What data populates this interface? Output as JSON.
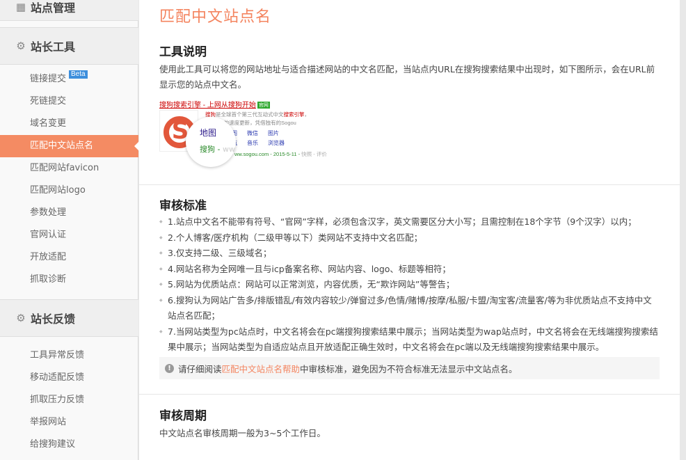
{
  "sidebar": {
    "top_section": {
      "label": "站点管理",
      "icon": "grid-icon"
    },
    "tools_section": {
      "label": "站长工具",
      "icon": "gear-icon"
    },
    "tools_items": [
      {
        "label": "链接提交",
        "badge": "Beta"
      },
      {
        "label": "死链提交"
      },
      {
        "label": "域名变更"
      },
      {
        "label": "匹配中文站点名",
        "active": true
      },
      {
        "label": "匹配网站favicon"
      },
      {
        "label": "匹配网站logo"
      },
      {
        "label": "参数处理"
      },
      {
        "label": "官网认证"
      },
      {
        "label": "开放适配"
      },
      {
        "label": "抓取诊断"
      }
    ],
    "feedback_section": {
      "label": "站长反馈",
      "icon": "gear-icon"
    },
    "feedback_items": [
      {
        "label": "工具异常反馈"
      },
      {
        "label": "移动适配反馈"
      },
      {
        "label": "抓取压力反馈"
      },
      {
        "label": "举报网站"
      },
      {
        "label": "给搜狗建议"
      }
    ]
  },
  "main": {
    "title": "匹配中文站点名",
    "intro_heading": "工具说明",
    "intro_text": "使用此工具可以将您的网站地址与适合描述网站的中文名匹配，当站点内URL在搜狗搜索结果中出现时，如下图所示，会在URL前显示您的站点中文名。",
    "example": {
      "title": "搜狗搜索引擎 - 上网从搜狗开始",
      "official": "官网",
      "line1_prefix": "搜狗",
      "line1_mid": "是全球首个第三代互动式中文",
      "line1_hl": "搜索引擎",
      "line1_suffix": "，",
      "line2": "天以5亿的速度更新，凭借独有的Sogou",
      "links_row1": [
        "地图",
        "微信",
        "图片"
      ],
      "links_row2": [
        "导航",
        "音乐",
        "浏览器"
      ],
      "url": "ww.sogou.com - 2015-5-11 - ",
      "url_tail": "快照 - 评价",
      "circle_line1": "地图",
      "circle_line2": "搜狗 - ",
      "circle_line2_tail": "ww"
    },
    "criteria_heading": "审核标准",
    "criteria": [
      "1.站点中文名不能带有符号、“官网”字样，必须包含汉字，英文需要区分大小写；且需控制在18个字节（9个汉字）以内；",
      "2.个人博客/医疗机构（二级甲等以下）类网站不支持中文名匹配；",
      "3.仅支持二级、三级域名；",
      "4.网站名称为全网唯一且与icp备案名称、网站内容、logo、标题等相符；",
      "5.网站为优质站点：网站可以正常浏览，内容优质，无“欺诈网站”等警告；",
      "6.搜狗认为网站广告多/排版错乱/有效内容较少/弹窗过多/色情/赌博/按摩/私服/卡盟/淘宝客/流量客/等为非优质站点不支持中文站点名匹配；",
      "7.当网站类型为pc站点时，中文名将会在pc端搜狗搜索结果中展示；当网站类型为wap站点时，中文名将会在无线端搜狗搜索结果中展示；当网站类型为自适应站点且开放适配正确生效时，中文名将会在pc端以及无线端搜狗搜索结果中展示。"
    ],
    "notice": {
      "icon": "exclamation-icon",
      "prefix": "请仔细阅读",
      "link": "匹配中文站点名帮助",
      "suffix": "中审核标准，避免因为不符合标准无法显示中文站点名。"
    },
    "cycle_heading": "审核周期",
    "cycle_text": "中文站点名审核周期一般为3~5个工作日。"
  },
  "colors": {
    "accent": "#f4845f",
    "active_bg": "#f48b63",
    "badge": "#3d8fdc"
  }
}
